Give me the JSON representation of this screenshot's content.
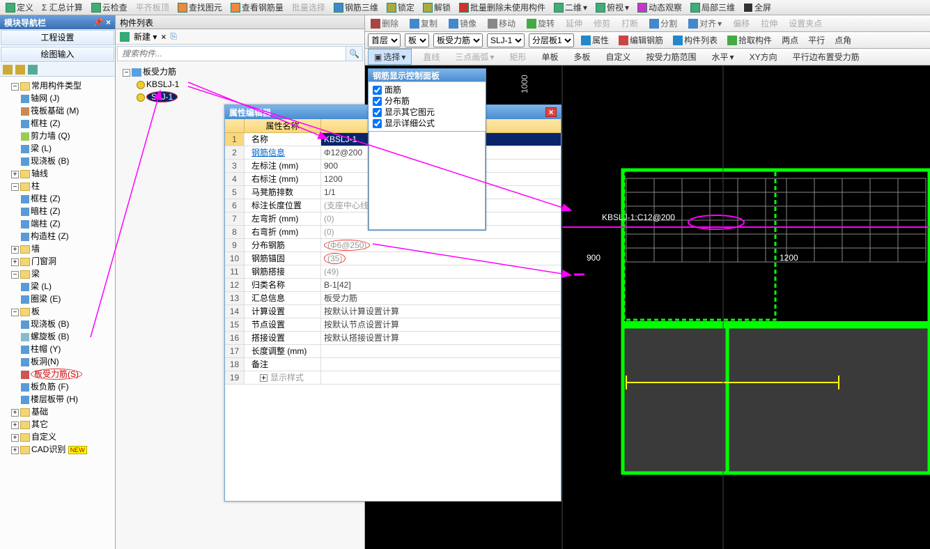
{
  "toolbar1": {
    "items": [
      "定义",
      "Σ 汇总计算",
      "云检查",
      "平齐板顶",
      "查找图元",
      "查看钢筋量",
      "批量选择",
      "钢筋三维",
      "锁定",
      "解锁",
      "批量删除未使用构件",
      "二维",
      "俯视",
      "动态观察",
      "局部三维",
      "全屏"
    ]
  },
  "toolbar2": {
    "items": [
      "删除",
      "复制",
      "镜像",
      "移动",
      "旋转",
      "延伸",
      "修剪",
      "打断",
      "分割",
      "对齐",
      "偏移",
      "拉伸",
      "设置夹点"
    ]
  },
  "toolbar3": {
    "floor": "首层",
    "cat": "板",
    "sub": "板受力筋",
    "item": "SLJ-1",
    "layer": "分层板1",
    "btns": [
      "属性",
      "编辑钢筋",
      "构件列表",
      "拾取构件",
      "两点",
      "平行",
      "点角"
    ]
  },
  "toolbar4": {
    "select": "选择",
    "items": [
      "直线",
      "三点画弧",
      "矩形",
      "单板",
      "多板",
      "自定义",
      "按受力筋范围",
      "水平",
      "XY方向",
      "平行边布置受力筋"
    ]
  },
  "nav": {
    "title": "模块导航栏",
    "tabs": [
      "工程设置",
      "绘图输入"
    ],
    "tree": {
      "root": "常用构件类型",
      "items": [
        "轴网 (J)",
        "筏板基础 (M)",
        "框柱 (Z)",
        "剪力墙 (Q)",
        "梁 (L)",
        "现浇板 (B)"
      ],
      "axis": "轴线",
      "col": {
        "label": "柱",
        "items": [
          "框柱 (Z)",
          "暗柱 (Z)",
          "端柱 (Z)",
          "构造柱 (Z)"
        ]
      },
      "wall": "墙",
      "door": "门窗洞",
      "beam": {
        "label": "梁",
        "items": [
          "梁 (L)",
          "圈梁 (E)"
        ]
      },
      "slab": {
        "label": "板",
        "items": [
          "现浇板 (B)",
          "螺旋板 (B)",
          "柱帽 (Y)",
          "板洞(N)",
          "板受力筋(S)",
          "板负筋 (F)",
          "楼层板带 (H)"
        ]
      },
      "found": "基础",
      "other": "其它",
      "custom": "自定义",
      "cad": "CAD识别",
      "new": "NEW"
    }
  },
  "list": {
    "title": "构件列表",
    "new": "新建",
    "search_ph": "搜索构件...",
    "root": "板受力筋",
    "items": [
      "KBSLJ-1",
      "SLJ-1"
    ]
  },
  "prop": {
    "title": "属性编辑器",
    "header": "属性名称",
    "rows": [
      {
        "n": "1",
        "k": "名称",
        "v": "KBSLJ-1",
        "sel": true
      },
      {
        "n": "2",
        "k": "钢筋信息",
        "v": "Φ12@200",
        "link": true
      },
      {
        "n": "3",
        "k": "左标注 (mm)",
        "v": "900"
      },
      {
        "n": "4",
        "k": "右标注 (mm)",
        "v": "1200"
      },
      {
        "n": "5",
        "k": "马凳筋排数",
        "v": "1/1"
      },
      {
        "n": "6",
        "k": "标注长度位置",
        "v": "(支座中心线)",
        "grey": true
      },
      {
        "n": "7",
        "k": "左弯折 (mm)",
        "v": "(0)",
        "grey": true
      },
      {
        "n": "8",
        "k": "右弯折 (mm)",
        "v": "(0)",
        "grey": true
      },
      {
        "n": "9",
        "k": "分布钢筋",
        "v": "(Φ6@250)",
        "circ": true
      },
      {
        "n": "10",
        "k": "钢筋锚固",
        "v": "(35)",
        "circ": true
      },
      {
        "n": "11",
        "k": "钢筋搭接",
        "v": "(49)",
        "grey": true
      },
      {
        "n": "12",
        "k": "归类名称",
        "v": "B-1[42]"
      },
      {
        "n": "13",
        "k": "汇总信息",
        "v": "板受力筋"
      },
      {
        "n": "14",
        "k": "计算设置",
        "v": "按默认计算设置计算"
      },
      {
        "n": "15",
        "k": "节点设置",
        "v": "按默认节点设置计算"
      },
      {
        "n": "16",
        "k": "搭接设置",
        "v": "按默认搭接设置计算"
      },
      {
        "n": "17",
        "k": "长度调整 (mm)",
        "v": ""
      },
      {
        "n": "18",
        "k": "备注",
        "v": ""
      },
      {
        "n": "19",
        "k": "显示样式",
        "v": "",
        "exp": true,
        "greykey": true
      }
    ]
  },
  "rebar_panel": {
    "title": "钢筋显示控制面板",
    "opts": [
      "面筋",
      "分布筋",
      "显示其它图元",
      "显示详细公式"
    ]
  },
  "canvas": {
    "label": "KBSLJ-1:C12@200",
    "left": "900",
    "right": "1200",
    "vaxis": "1000"
  }
}
